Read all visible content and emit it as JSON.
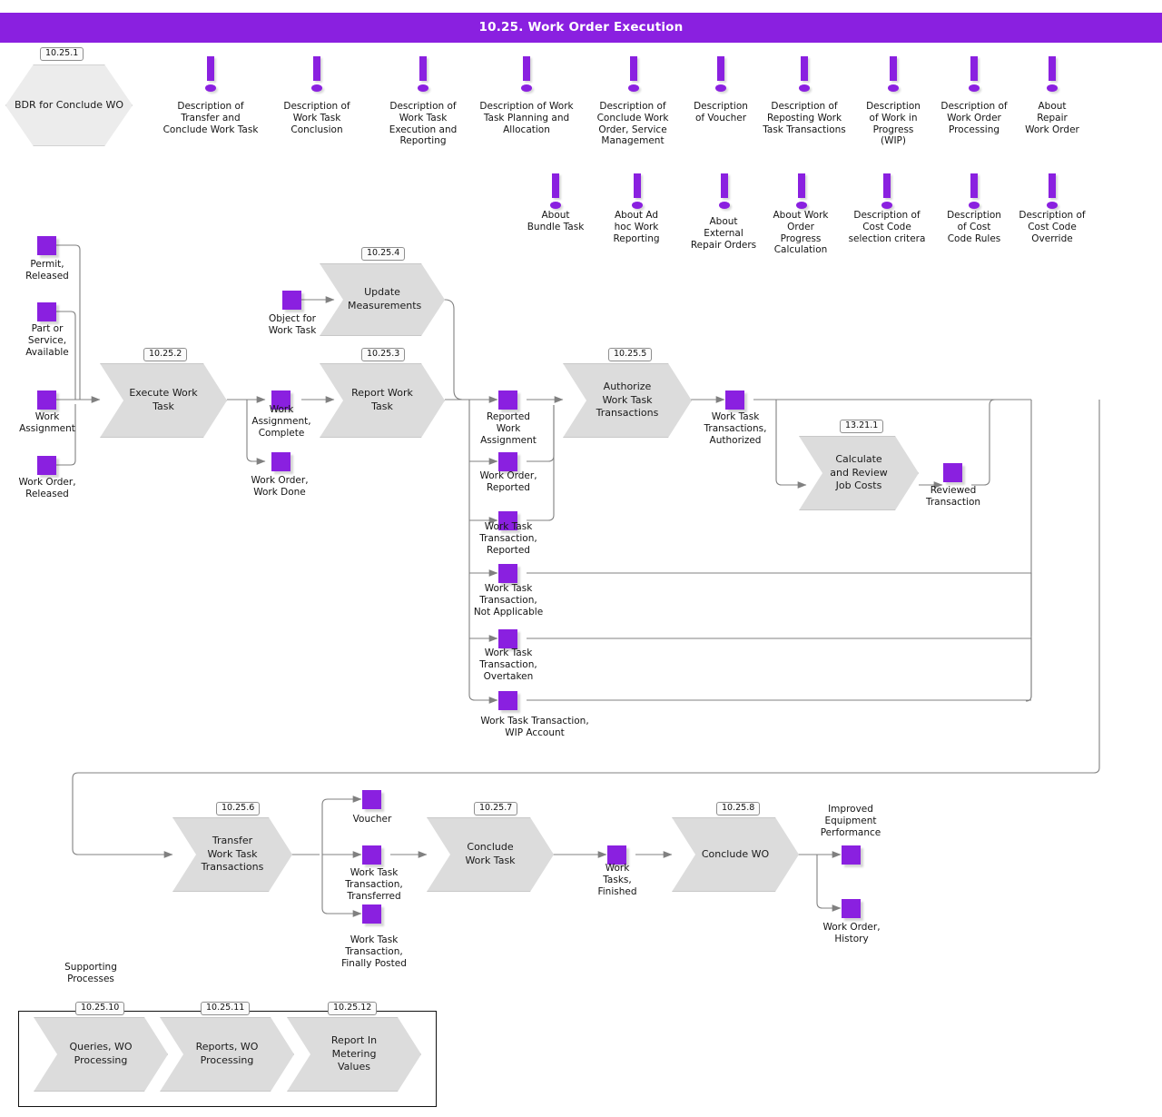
{
  "header": {
    "title": "10.25. Work Order Execution",
    "bar_color": "#8a20e0",
    "text_color": "#ffffff"
  },
  "theme": {
    "accent_purple": "#8a20e0",
    "process_fill": "#dcdcdc",
    "hexagon_fill": "#ececec",
    "edge_color": "#808080",
    "tag_border": "#8f8f8f",
    "background": "#ffffff"
  },
  "bdr": {
    "tag": "10.25.1",
    "label": "BDR for\nConclude WO"
  },
  "info_markers_row1": [
    {
      "icon": "exclamation-icon",
      "label": "Description of\nTransfer and\nConclude Work Task"
    },
    {
      "icon": "exclamation-icon",
      "label": "Description of\nWork Task\nConclusion"
    },
    {
      "icon": "exclamation-icon",
      "label": "Description of\nWork Task\nExecution and\nReporting"
    },
    {
      "icon": "exclamation-icon",
      "label": "Description of Work\nTask Planning and\nAllocation"
    },
    {
      "icon": "exclamation-icon",
      "label": "Description of\nConclude Work\nOrder, Service\nManagement"
    },
    {
      "icon": "exclamation-icon",
      "label": "Description\nof Voucher"
    },
    {
      "icon": "exclamation-icon",
      "label": "Description of\nReposting Work\nTask Transactions"
    },
    {
      "icon": "exclamation-icon",
      "label": "Description\nof Work in\nProgress\n(WIP)"
    },
    {
      "icon": "exclamation-icon",
      "label": "Description of\nWork Order\nProcessing"
    },
    {
      "icon": "exclamation-icon",
      "label": "About\nRepair\nWork Order"
    }
  ],
  "info_markers_row2": [
    {
      "icon": "exclamation-icon",
      "label": "About\nBundle Task"
    },
    {
      "icon": "exclamation-icon",
      "label": "About Ad\nhoc Work\nReporting"
    },
    {
      "icon": "exclamation-icon",
      "label": "About\nExternal\nRepair Orders"
    },
    {
      "icon": "exclamation-icon",
      "label": "About Work\nOrder\nProgress\nCalculation"
    },
    {
      "icon": "exclamation-icon",
      "label": "Description of\nCost Code\nselection critera"
    },
    {
      "icon": "exclamation-icon",
      "label": "Description\nof Cost\nCode Rules"
    },
    {
      "icon": "exclamation-icon",
      "label": "Description of\nCost Code\nOverride"
    }
  ],
  "processes": {
    "execute_work_task": {
      "tag": "10.25.2",
      "label": "Execute Work\nTask"
    },
    "update_measurements": {
      "tag": "10.25.4",
      "label": "Update\nMeasurements"
    },
    "report_work_task": {
      "tag": "10.25.3",
      "label": "Report Work\nTask"
    },
    "authorize_wtt": {
      "tag": "10.25.5",
      "label": "Authorize Work\nTask\nTransactions"
    },
    "calculate_job_costs": {
      "tag": "13.21.1",
      "label": "Calculate and\nReview Job\nCosts"
    },
    "transfer_wtt": {
      "tag": "10.25.6",
      "label": "Transfer Work\nTask\nTransactions"
    },
    "conclude_work_task": {
      "tag": "10.25.7",
      "label": "Conclude Work\nTask"
    },
    "conclude_wo": {
      "tag": "10.25.8",
      "label": "Conclude WO"
    }
  },
  "entities": {
    "permit_released": "Permit,\nReleased",
    "part_service_available": "Part or\nService,\nAvailable",
    "work_assignment": "Work\nAssignment",
    "work_order_released": "Work Order,\nReleased",
    "object_for_work_task": "Object for\nWork Task",
    "work_assignment_complete": "Work\nAssignment,\nComplete",
    "work_order_work_done": "Work Order,\nWork Done",
    "reported_work_assignment": "Reported\nWork\nAssignment",
    "work_order_reported": "Work Order,\nReported",
    "wtt_reported": "Work Task\nTransaction,\nReported",
    "wtt_not_applicable": "Work Task\nTransaction,\nNot Applicable",
    "wtt_overtaken": "Work Task\nTransaction,\nOvertaken",
    "wtt_wip_account": "Work Task Transaction,\nWIP Account",
    "wtt_authorized": "Work Task\nTransactions,\nAuthorized",
    "reviewed_transaction": "Reviewed\nTransaction",
    "voucher": "Voucher",
    "wtt_transferred": "Work Task\nTransaction,\nTransferred",
    "wtt_finally_posted": "Work Task\nTransaction,\nFinally Posted",
    "work_tasks_finished": "Work\nTasks,\nFinished",
    "improved_equipment_performance": "Improved\nEquipment\nPerformance",
    "work_order_history": "Work Order,\nHistory"
  },
  "supporting": {
    "caption": "Supporting\nProcesses",
    "items": [
      {
        "tag": "10.25.10",
        "label": "Queries, WO\nProcessing"
      },
      {
        "tag": "10.25.11",
        "label": "Reports, WO\nProcessing"
      },
      {
        "tag": "10.25.12",
        "label": "Report In\nMetering\nValues"
      }
    ]
  }
}
